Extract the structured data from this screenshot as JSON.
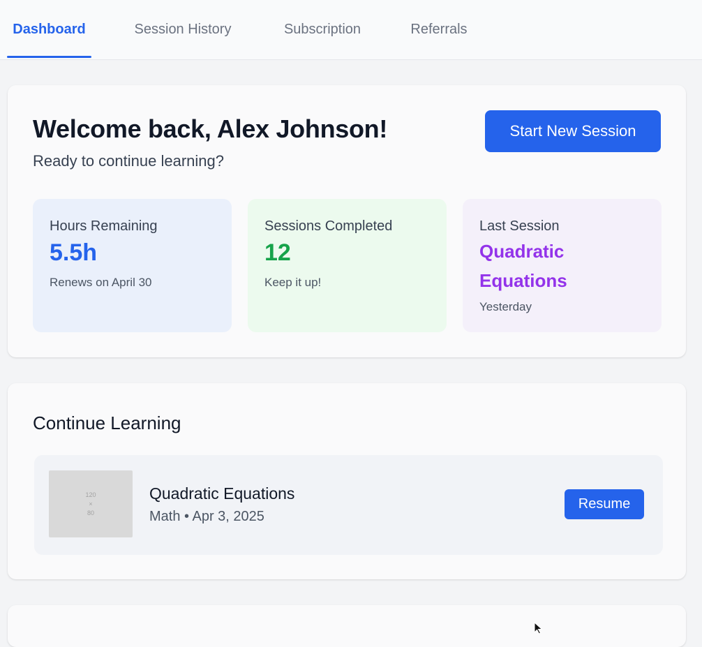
{
  "tabs": [
    {
      "label": "Dashboard",
      "active": true
    },
    {
      "label": "Session History",
      "active": false
    },
    {
      "label": "Subscription",
      "active": false
    },
    {
      "label": "Referrals",
      "active": false
    }
  ],
  "welcome": {
    "title": "Welcome back, Alex Johnson!",
    "subtitle": "Ready to continue learning?",
    "cta_label": "Start New Session"
  },
  "stats": [
    {
      "label": "Hours Remaining",
      "value": "5.5h",
      "note": "Renews on April 30",
      "accent": "#2563eb",
      "bg": "#eaf0fb"
    },
    {
      "label": "Sessions Completed",
      "value": "12",
      "note": "Keep it up!",
      "accent": "#16a34a",
      "bg": "#ecfaee"
    },
    {
      "label": "Last Session",
      "value": "Quadratic Equations",
      "note": "Yesterday",
      "accent": "#9333ea",
      "bg": "#f4f0fa"
    }
  ],
  "continue_learning": {
    "title": "Continue Learning",
    "items": [
      {
        "thumb_text": [
          "120",
          "×",
          "80"
        ],
        "title": "Quadratic Equations",
        "meta": "Math • Apr 3, 2025",
        "action_label": "Resume"
      }
    ]
  },
  "colors": {
    "primary": "#2563eb",
    "page_bg": "#f3f4f6",
    "card_bg": "#fafafb"
  }
}
